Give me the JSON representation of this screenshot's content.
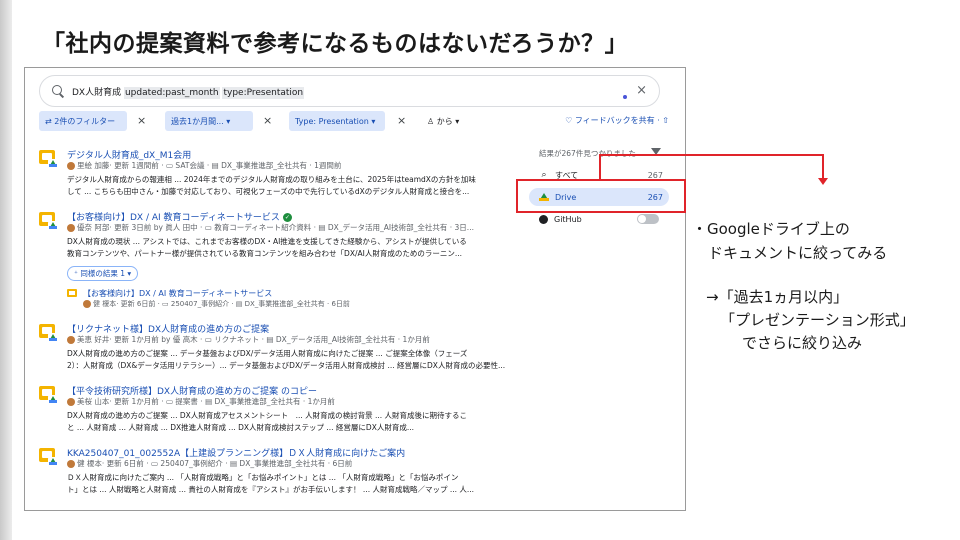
{
  "slide": {
    "title": "「社内の提案資料で参考になるものはないだろうか？」"
  },
  "search": {
    "query_plain": "DX人財育成 ",
    "query_chip1": "updated:past_month",
    "query_chip2": "type:Presentation",
    "clear_label": "×"
  },
  "filters": {
    "count_label": "⇄ 2件のフィルター",
    "date_label": "過去1か月間... ▾",
    "type_label": "Type: Presentation ▾",
    "from_label": "♙ から ▾",
    "remove_label": "×",
    "feedback_label": "♡ フィードバックを共有 · ⇧"
  },
  "results": [
    {
      "title": "デジタル人財育成_dX_M1会用",
      "meta": "里絵 加藤· 更新 1週間前 · ▭ SAT会議 · ▤ DX_事業推進部_全社共有 · 1週間前",
      "snippet1": "デジタル人財育成からの報連相 ... 2024年までのデジタル人財育成の取り組みを土台に、2025年はteamdXの方針を加味",
      "snippet2": "して ... こちらも田中さん・加藤で対応しており、可視化フェーズの中で先行しているdXのデジタル人財育成と接合を..."
    },
    {
      "title": "【お客様向け】DX / AI 教育コーディネートサービス",
      "meta": "優奈 阿部· 更新 3日前 by 眞人 田中 · ▭ 教育コーディネート紹介資料 · ▤ DX_データ活用_AI技術部_全社共有 · 3日...",
      "snippet1": "DX人財育成の現状 ... アシストでは、これまでお客様のDX・AI推進を支援してきた経験から、アシストが提供している",
      "snippet2": "教育コンテンツや、パートナー様が提供されている教育コンテンツを組み合わせ「DX/AI人財育成のためのラーニン...",
      "similar": "⁺ 同様の結果 1 ▾",
      "sub_title": "【お客様向け】DX / AI 教育コーディネートサービス",
      "sub_meta": "健 榎本· 更新 6日前 · ▭ 250407_事例紹介 · ▤ DX_事業推進部_全社共有 · 6日前"
    },
    {
      "title": "【リクナネット様】DX人財育成の進め方のご提案",
      "meta": "美恵 好井· 更新 1か月前 by 優 高木 · ▭ リクナネット · ▤ DX_データ活用_AI技術部_全社共有 · 1か月前",
      "snippet1": "DX人財育成の進め方のご提案 ... データ基盤およびDX/データ活用人財育成に向けたご提案 ... ご提案全体像（フェーズ",
      "snippet2": "2）：人財育成（DX&データ活用リテラシー）... データ基盤およびDX/データ活用人財育成検討 ... 経営層にDX人財育成の必要性..."
    },
    {
      "title": "【平令技術研究所様】DX人財育成の進め方のご提案 のコピー",
      "meta": "美桜 山本· 更新 1か月前 · ▭ 提案書 · ▤ DX_事業推進部_全社共有 · 1か月前",
      "snippet1": "DX人財育成の進め方のご提案 ... DX人財育成アセスメントシート　... 人財育成の検討背景 ... 人財育成後に期待するこ",
      "snippet2": "と ... 人財育成 ... 人財育成 ... DX推進人財育成 ... DX人財育成検討ステップ ... 経営層にDX人財育成..."
    },
    {
      "title": "KKA250407_01_002552A【上建設プランニング様】ＤＸ人財育成に向けたご案内",
      "meta": "健 榎本· 更新 6日前 · ▭ 250407_事例紹介 · ▤ DX_事業推進部_全社共有 · 6日前",
      "snippet1": "ＤＸ人財育成に向けたご案内 ... 「人財育成戦略」と「お悩みポイント」とは ... 「人財育成戦略」と「お悩みポイン",
      "snippet2": "ト」とは ... 人財戦略と人財育成 ... 貴社の人財育成を『アシスト』がお手伝いします！ ... 人財育成戦略／マップ ... 人..."
    }
  ],
  "panel": {
    "count": "結果が267件見つかりました",
    "sources": [
      {
        "label": "すべて",
        "count": "267"
      },
      {
        "label": "Drive",
        "count": "267"
      },
      {
        "label": "GitHub",
        "count": ""
      }
    ]
  },
  "annotation": {
    "line1": "・Googleドライブ上の",
    "line2": "ドキュメントに絞ってみる",
    "line3": "→「過去1ヵ月以内」",
    "line4": "「プレゼンテーション形式」",
    "line5": "でさらに絞り込み"
  },
  "colors": {
    "accent_red": "#e0242a",
    "link_blue": "#1a4fb3",
    "chip_blue": "#dbe6fb"
  }
}
